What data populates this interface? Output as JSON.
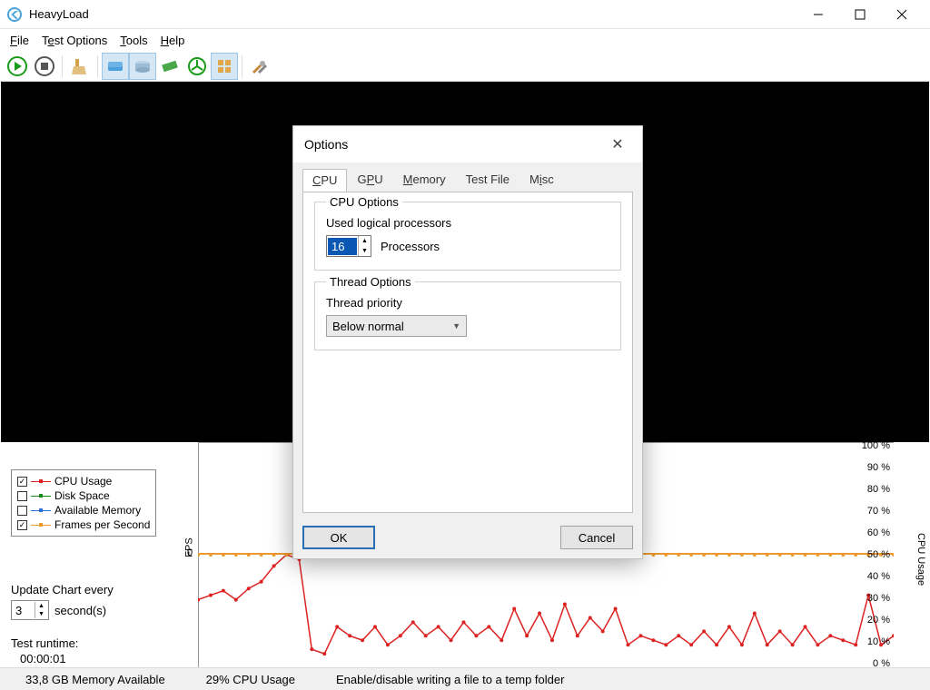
{
  "window": {
    "title": "HeavyLoad"
  },
  "menu": {
    "file": "File",
    "testoptions": "Test Options",
    "tools": "Tools",
    "help": "Help"
  },
  "toolbar": {
    "play": "play",
    "stop": "stop",
    "clean": "clean",
    "t1": "disk-blue",
    "t2": "hdd",
    "t3": "ram",
    "t4": "proc",
    "t5": "tile",
    "settings": "settings"
  },
  "legend": {
    "items": [
      {
        "checked": true,
        "color": "#d22",
        "label": "CPU Usage"
      },
      {
        "checked": false,
        "color": "#1a8a1a",
        "label": "Disk Space"
      },
      {
        "checked": false,
        "color": "#2a6fd6",
        "label": "Available Memory"
      },
      {
        "checked": true,
        "color": "#ec9a2e",
        "label": "Frames per Second"
      }
    ]
  },
  "chart": {
    "fps_axis_label": "FPS",
    "fps_tick": "0",
    "right_axis_label": "CPU Usage",
    "right_ticks": [
      "100 %",
      "90 %",
      "80 %",
      "70 %",
      "60 %",
      "50 %",
      "40 %",
      "30 %",
      "20 %",
      "10 %",
      "0 %"
    ],
    "update_label": "Update Chart every",
    "update_value": "3",
    "update_unit": "second(s)",
    "runtime_label": "Test runtime:",
    "runtime_value": "00:00:01"
  },
  "chart_data": {
    "type": "line",
    "series": [
      {
        "name": "CPU Usage",
        "color": "#d22",
        "unit": "%",
        "ylim": [
          0,
          100
        ],
        "values": [
          30,
          32,
          34,
          30,
          35,
          38,
          45,
          50,
          48,
          8,
          6,
          18,
          14,
          12,
          18,
          10,
          14,
          20,
          14,
          18,
          12,
          20,
          14,
          18,
          12,
          26,
          14,
          24,
          12,
          28,
          14,
          22,
          16,
          26,
          10,
          14,
          12,
          10,
          14,
          10,
          16,
          10,
          18,
          10,
          24,
          10,
          16,
          10,
          18,
          10,
          14,
          12,
          10,
          32,
          10,
          14
        ]
      },
      {
        "name": "Frames per Second",
        "color": "#ec9a2e",
        "unit": "",
        "values_constant_at_percent": 50
      }
    ]
  },
  "status": {
    "mem": "33,8 GB Memory Available",
    "cpu": "29% CPU Usage",
    "hint": "Enable/disable writing a file to a temp folder"
  },
  "dialog": {
    "title": "Options",
    "tabs": {
      "cpu": "CPU",
      "gpu": "GPU",
      "memory": "Memory",
      "testfile": "Test File",
      "misc": "Misc"
    },
    "cpu_group": "CPU Options",
    "used_label": "Used logical processors",
    "used_value": "16",
    "used_unit": "Processors",
    "thread_group": "Thread Options",
    "thread_label": "Thread priority",
    "thread_value": "Below normal",
    "ok": "OK",
    "cancel": "Cancel"
  }
}
